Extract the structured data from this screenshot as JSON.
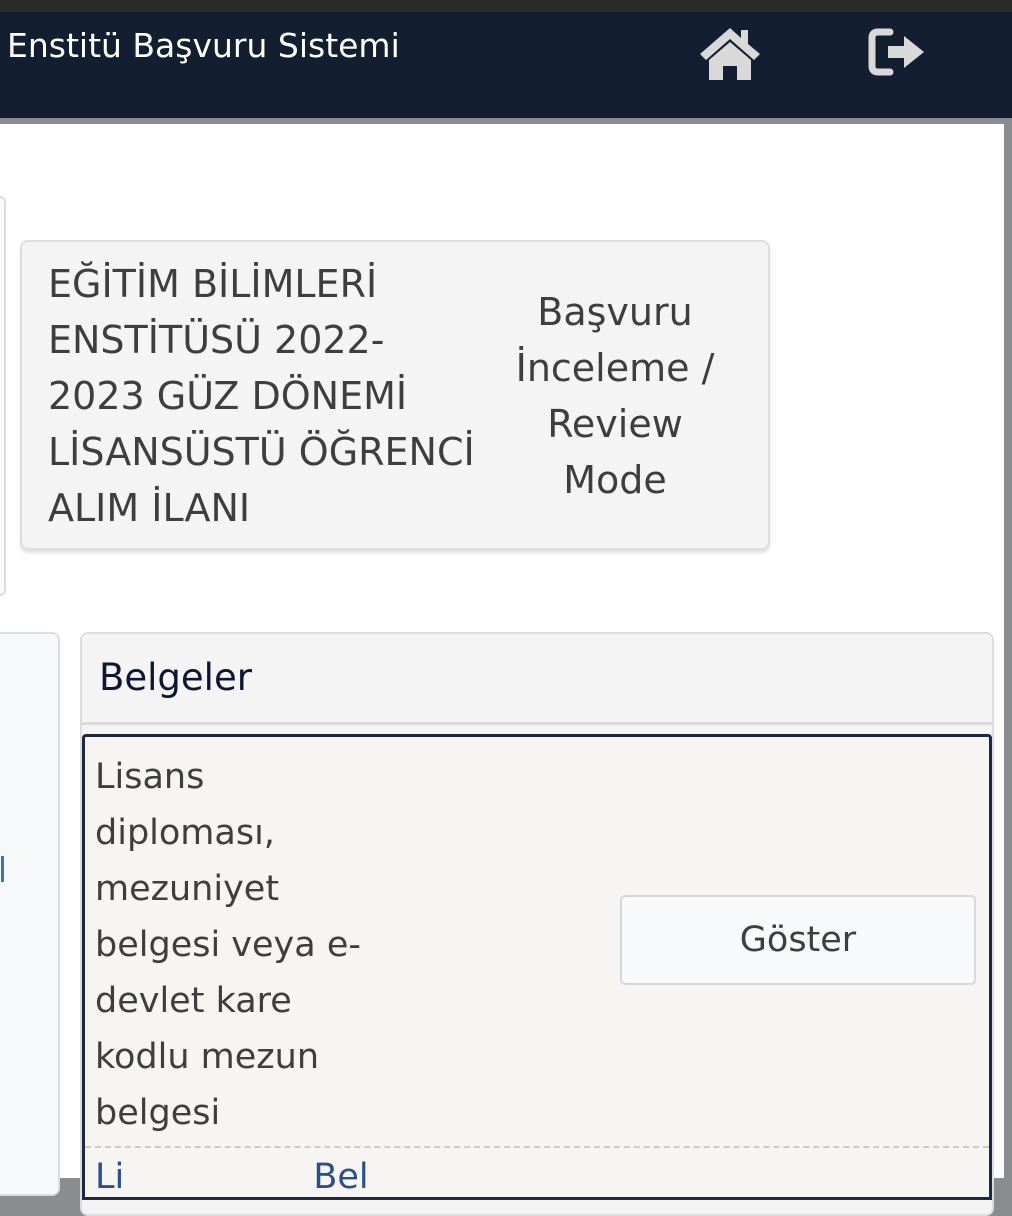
{
  "navbar": {
    "title": "Enstitü Başvuru Sistemi",
    "home_icon": "home-icon",
    "logout_icon": "logout-icon"
  },
  "announcement": {
    "title": "EĞİTİM BİLİMLERİ ENSTİTÜSÜ 2022-2023 GÜZ DÖNEMİ LİSANSÜSTÜ ÖĞRENCİ ALIM İLANI",
    "mode_label": "Başvuru İnceleme / Review Mode"
  },
  "documents": {
    "title": "Belgeler",
    "items": [
      {
        "name": "Lisans diploması, mezuniyet belgesi veya e-devlet kare kodlu mezun belgesi",
        "action_label": "Göster"
      },
      {
        "name_partial": "Li                 Bel"
      }
    ]
  },
  "colors": {
    "navbar_bg": "#131f30",
    "card_bg": "#f4f4f4",
    "doc_border": "#1a2a44",
    "title_color": "#0e1434",
    "link_color": "#2a4f8f"
  }
}
